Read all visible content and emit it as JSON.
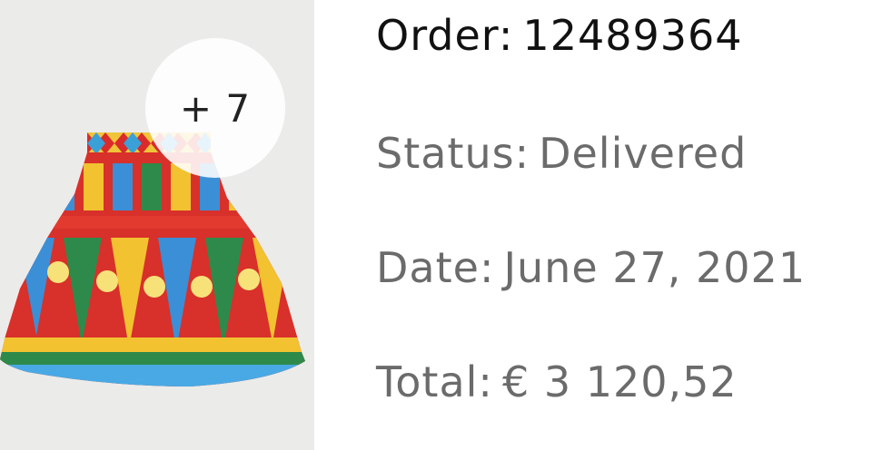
{
  "order": {
    "label": "Order:",
    "number": "12489364"
  },
  "status": {
    "label": "Status:",
    "value": "Delivered"
  },
  "date": {
    "label": "Date:",
    "value": "June 27, 2021"
  },
  "total": {
    "label": "Total:",
    "value": "€ 3 120,52"
  },
  "thumbnail": {
    "more_count": "+ 7",
    "image": "printed-skirt-image"
  },
  "colors": {
    "primary_text": "#111111",
    "secondary_text": "#6b6b6b",
    "thumb_background": "#ebebea"
  }
}
